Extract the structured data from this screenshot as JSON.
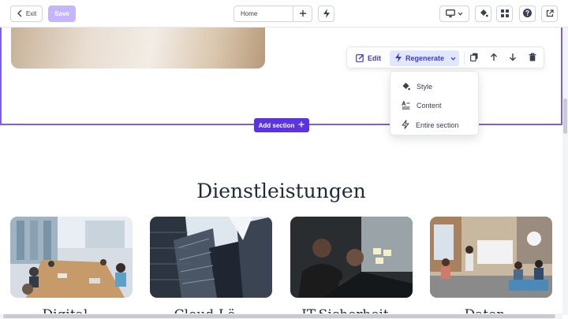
{
  "toolbar": {
    "exit_label": "Exit",
    "save_label": "Save",
    "page_select_value": "Home"
  },
  "ai_toolbar": {
    "edit_label": "Edit",
    "regenerate_label": "Regenerate"
  },
  "regenerate_menu": {
    "items": [
      {
        "label": "Style",
        "icon": "paint-bucket-icon"
      },
      {
        "label": "Content",
        "icon": "text-content-icon"
      },
      {
        "label": "Entire section",
        "icon": "bolt-icon"
      }
    ]
  },
  "add_section_label": "Add section",
  "services": {
    "heading": "Dienstleistungen",
    "cards": [
      {
        "title": "Digital..."
      },
      {
        "title": "Cloud-Lö..."
      },
      {
        "title": "IT-Sicherheit..."
      },
      {
        "title": "Daten..."
      }
    ]
  },
  "colors": {
    "accent": "#5b34e0",
    "accent_light": "#e0e7ff",
    "save_disabled": "#c4b5fd",
    "section_border": "#7c5fe6"
  }
}
